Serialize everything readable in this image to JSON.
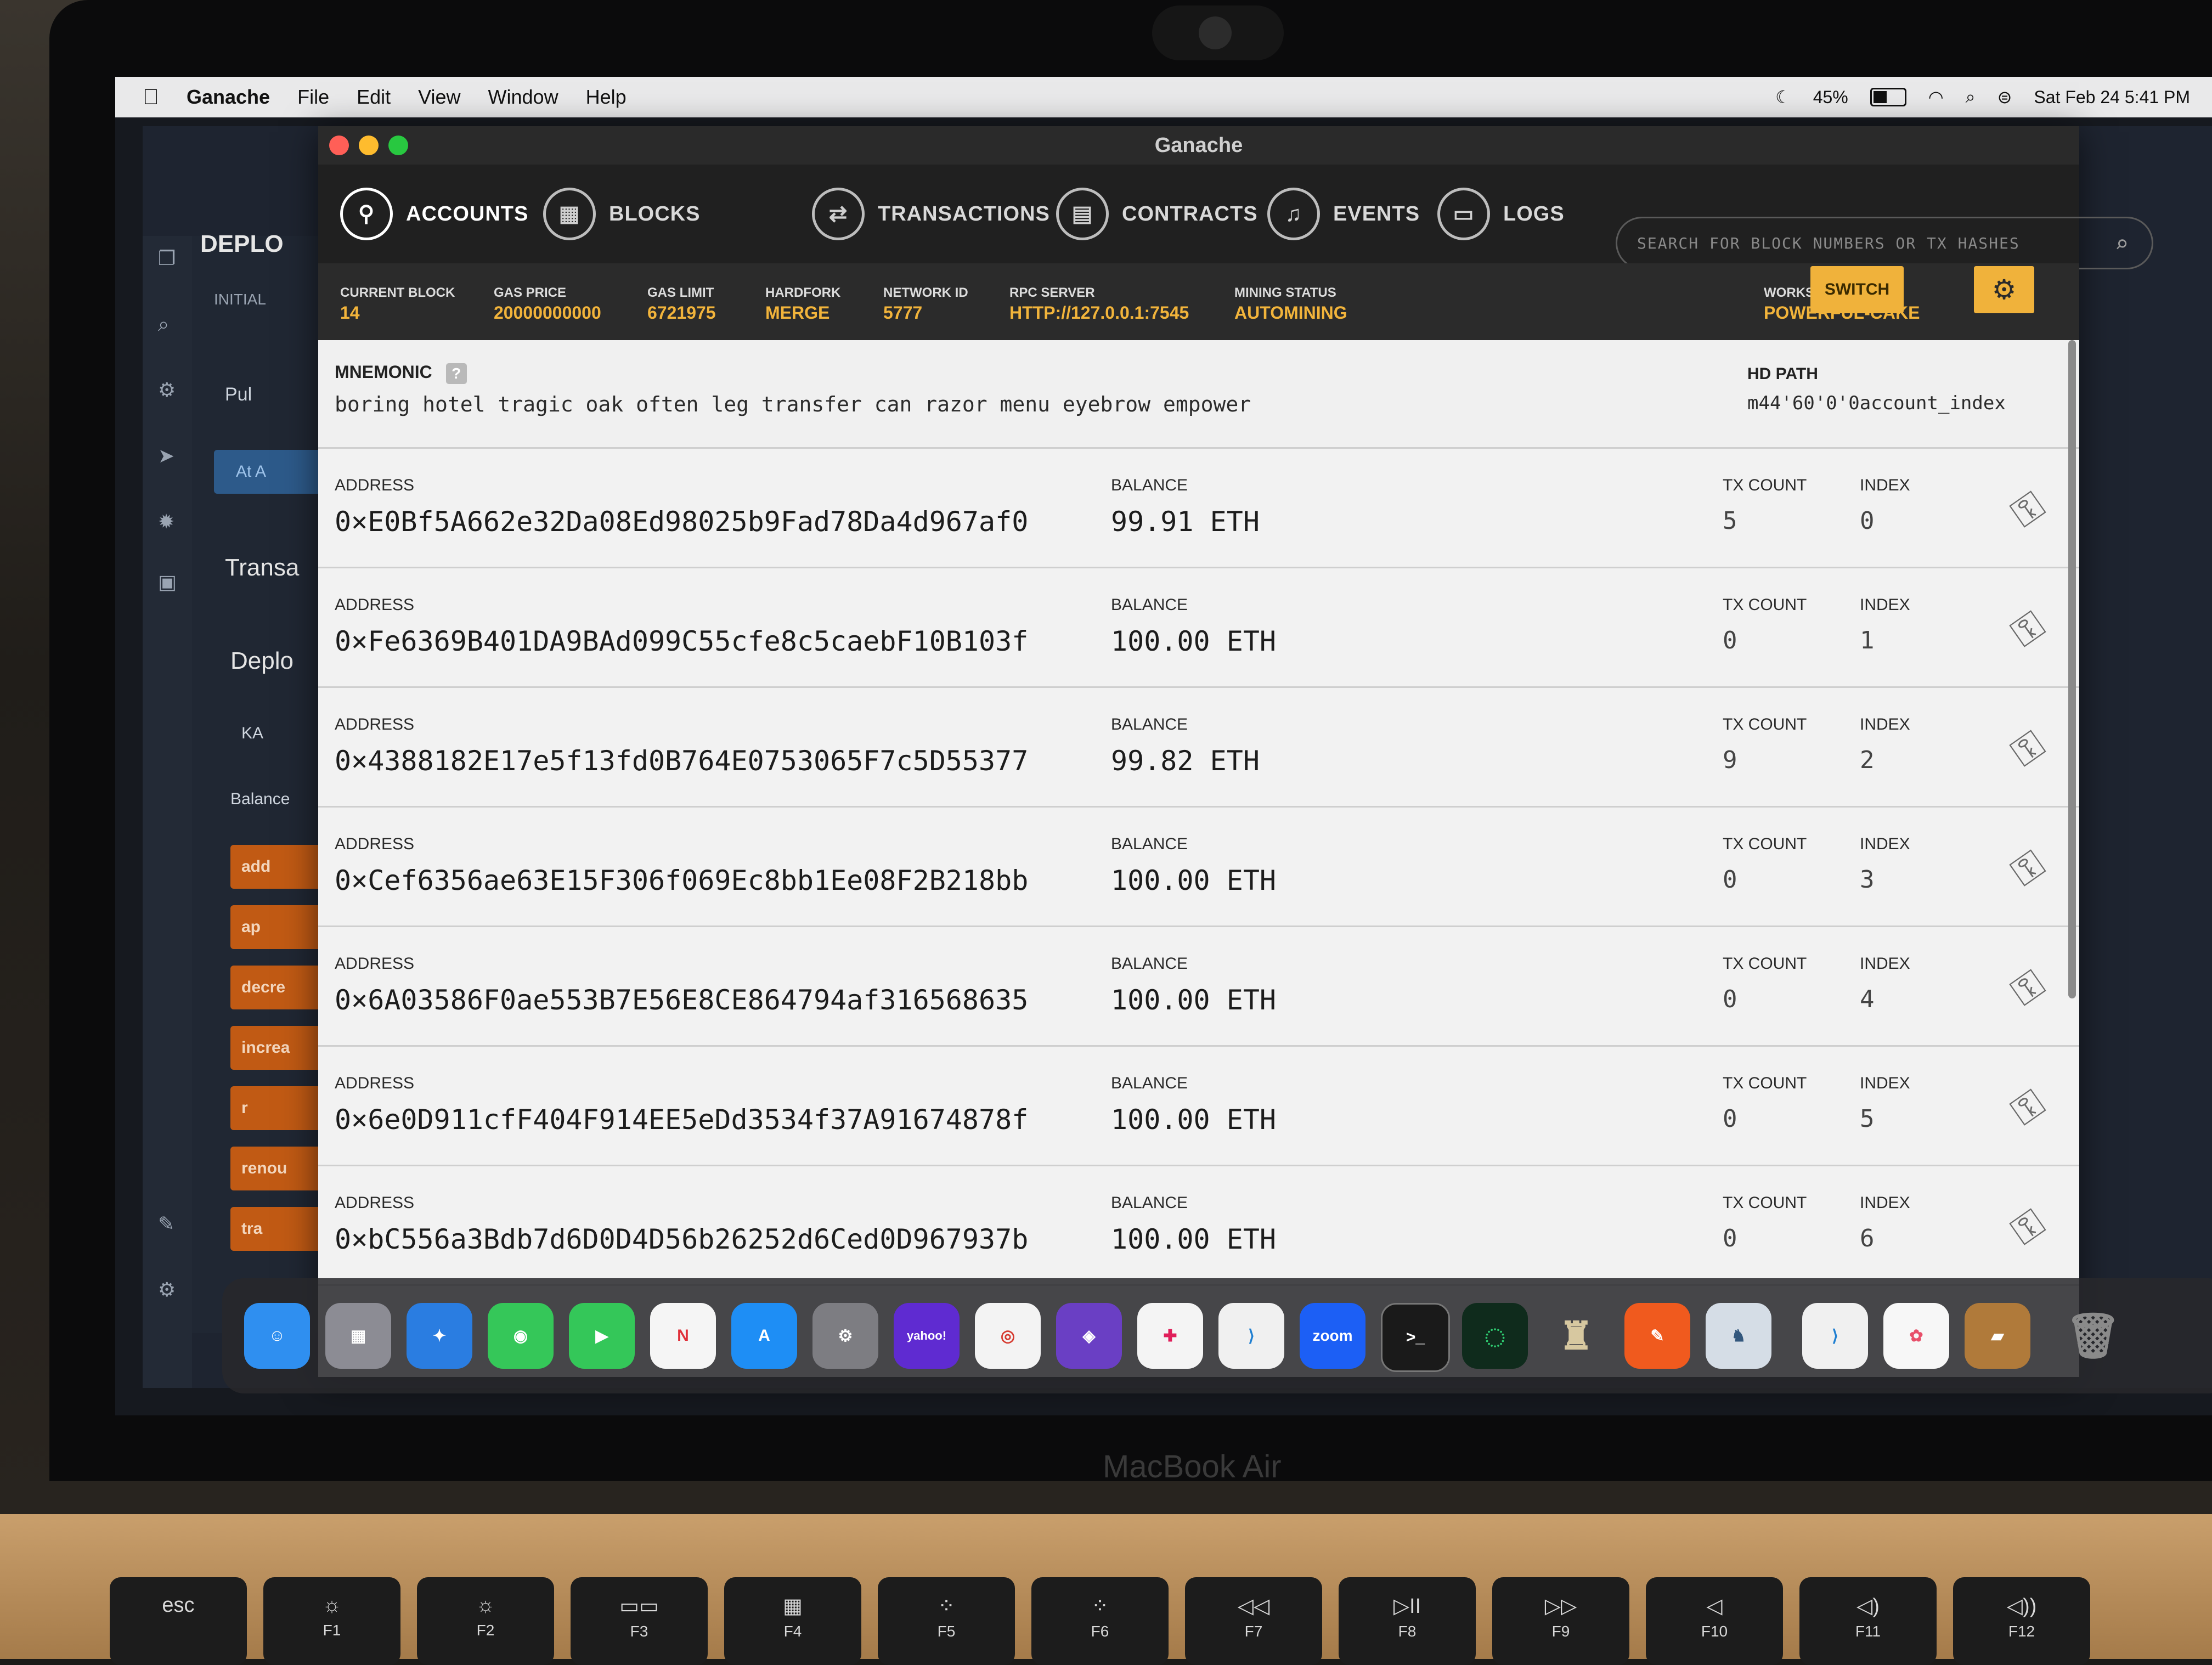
{
  "menubar": {
    "app": "Ganache",
    "items": [
      "File",
      "Edit",
      "View",
      "Window",
      "Help"
    ],
    "battery": "45%",
    "datetime": "Sat Feb 24  5:41 PM"
  },
  "background_app": {
    "title": "DEPLO",
    "initial": "INITIAL",
    "pub": "Pul",
    "at": "At A",
    "transact": "Transa",
    "deploy": "Deplo",
    "ka": "KA",
    "balance": "Balance",
    "buttons": [
      "add",
      "ap",
      "decre",
      "increa",
      "r",
      "renou",
      "tra"
    ]
  },
  "window": {
    "title": "Ganache",
    "nav": [
      "ACCOUNTS",
      "BLOCKS",
      "TRANSACTIONS",
      "CONTRACTS",
      "EVENTS",
      "LOGS"
    ],
    "search_placeholder": "SEARCH FOR BLOCK NUMBERS OR TX HASHES"
  },
  "stats": [
    {
      "label": "CURRENT BLOCK",
      "value": "14"
    },
    {
      "label": "GAS PRICE",
      "value": "20000000000"
    },
    {
      "label": "GAS LIMIT",
      "value": "6721975"
    },
    {
      "label": "HARDFORK",
      "value": "MERGE"
    },
    {
      "label": "NETWORK ID",
      "value": "5777"
    },
    {
      "label": "RPC SERVER",
      "value": "HTTP://127.0.0.1:7545"
    },
    {
      "label": "MINING STATUS",
      "value": "AUTOMINING"
    }
  ],
  "workspace": {
    "label": "WORKSPACE",
    "value": "POWERFUL-CAKE"
  },
  "switch_label": "SWITCH",
  "mnemonic": {
    "label": "MNEMONIC",
    "help": "?",
    "words": "boring hotel tragic oak often leg transfer can razor menu eyebrow empower",
    "hd_label": "HD PATH",
    "hd_path": "m44'60'0'0account_index"
  },
  "labels": {
    "address": "ADDRESS",
    "balance": "BALANCE",
    "tx_count": "TX COUNT",
    "index": "INDEX"
  },
  "accounts": [
    {
      "address": "0×E0Bf5A662e32Da08Ed98025b9Fad78Da4d967af0",
      "balance": "99.91  ETH",
      "tx_count": "5",
      "index": "0"
    },
    {
      "address": "0×Fe6369B401DA9BAd099C55cfe8c5caebF10B103f",
      "balance": "100.00  ETH",
      "tx_count": "0",
      "index": "1"
    },
    {
      "address": "0×4388182E17e5f13fd0B764E0753065F7c5D55377",
      "balance": "99.82  ETH",
      "tx_count": "9",
      "index": "2"
    },
    {
      "address": "0×Cef6356ae63E15F306f069Ec8bb1Ee08F2B218bb",
      "balance": "100.00  ETH",
      "tx_count": "0",
      "index": "3"
    },
    {
      "address": "0×6A03586F0ae553B7E56E8CE864794af316568635",
      "balance": "100.00  ETH",
      "tx_count": "0",
      "index": "4"
    },
    {
      "address": "0×6e0D911cfF404F914EE5eDd3534f37A91674878f",
      "balance": "100.00  ETH",
      "tx_count": "0",
      "index": "5"
    },
    {
      "address": "0×bC556a3Bdb7d6D0D4D56b26252d6Ced0D967937b",
      "balance": "100.00  ETH",
      "tx_count": "0",
      "index": "6"
    }
  ],
  "dock": {
    "apps": [
      "finder",
      "launchpad",
      "safari",
      "messages",
      "facetime",
      "news",
      "app-store",
      "system-settings",
      "yahoo-mail",
      "chrome",
      "github-desktop",
      "slack",
      "vscode",
      "zoom",
      "terminal",
      "ganache",
      "rocket",
      "pen",
      "postgres",
      "vscode-2",
      "photos",
      "cake",
      "trash"
    ],
    "yahoo": "yahoo!",
    "zoom": "zoom",
    "terminal": ">_"
  },
  "device_label": "MacBook Air",
  "keys": [
    {
      "top": "esc",
      "bottom": ""
    },
    {
      "top": "☼",
      "bottom": "F1"
    },
    {
      "top": "☼",
      "bottom": "F2"
    },
    {
      "top": "▭▭",
      "bottom": "F3"
    },
    {
      "top": "▦",
      "bottom": "F4"
    },
    {
      "top": "⁘",
      "bottom": "F5"
    },
    {
      "top": "⁘",
      "bottom": "F6"
    },
    {
      "top": "◁◁",
      "bottom": "F7"
    },
    {
      "top": "▷II",
      "bottom": "F8"
    },
    {
      "top": "▷▷",
      "bottom": "F9"
    },
    {
      "top": "◁",
      "bottom": "F10"
    },
    {
      "top": "◁)",
      "bottom": "F11"
    },
    {
      "top": "◁))",
      "bottom": "F12"
    }
  ]
}
